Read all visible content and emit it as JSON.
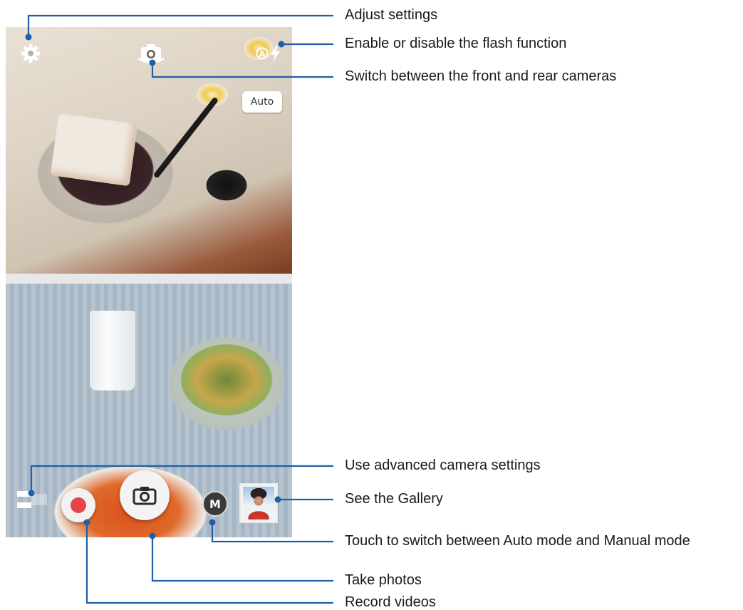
{
  "camera_ui": {
    "auto_badge": "Auto",
    "mode_button_label": "M",
    "icons": {
      "settings": "gear-icon",
      "switch_camera": "camera-switch-icon",
      "flash": "flash-auto-icon",
      "flash_mode_letter": "A",
      "shutter": "camera-icon",
      "record": "record-dot-icon"
    },
    "colors": {
      "record_dot": "#e8424a",
      "leader_line": "#1f5fa8",
      "mode_button": "#3a3a3a"
    }
  },
  "callouts": {
    "settings": "Adjust settings",
    "flash": "Enable or disable the flash function",
    "switch_camera": "Switch between the front and rear cameras",
    "advanced": "Use advanced camera settings",
    "gallery": "See the Gallery",
    "mode": "Touch to switch between Auto mode and Manual mode",
    "photo": "Take photos",
    "video": "Record videos"
  }
}
